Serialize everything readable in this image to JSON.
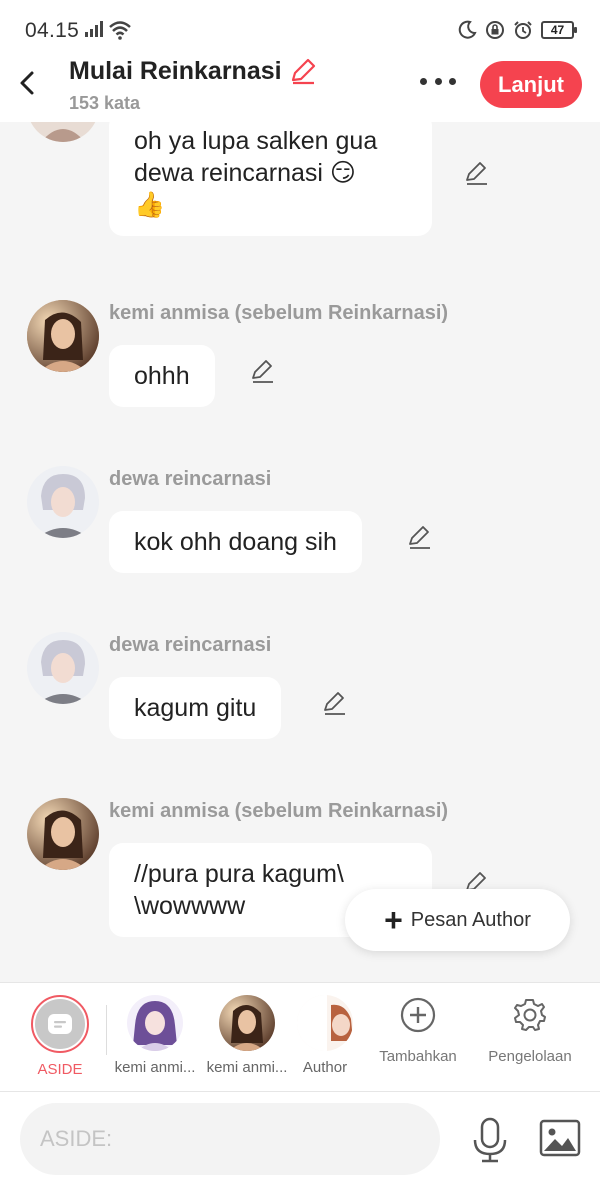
{
  "status": {
    "time": "04.15",
    "battery": "47"
  },
  "header": {
    "title": "Mulai Reinkarnasi",
    "word_count": "153 kata",
    "next_label": "Lanjut"
  },
  "messages": [
    {
      "sender": "",
      "text": "oh ya lupa salken gua dewa reincarnasi 😏 👍",
      "lines": [
        "oh ya lupa salken gua",
        "dewa reincarnasi 😏",
        "👍"
      ]
    },
    {
      "sender": "kemi anmisa (sebelum Reinkarnasi)",
      "text": "ohhh"
    },
    {
      "sender": "dewa reincarnasi",
      "text": "kok ohh doang sih"
    },
    {
      "sender": "dewa reincarnasi",
      "text": "kagum gitu"
    },
    {
      "sender": "kemi anmisa (sebelum Reinkarnasi)",
      "lines": [
        "//pura pura kagum\\",
        "\\wowwww"
      ]
    }
  ],
  "fab": {
    "label": "Pesan Author"
  },
  "characters": [
    {
      "label": "ASIDE"
    },
    {
      "label": "kemi anmi..."
    },
    {
      "label": "kemi anmi..."
    },
    {
      "label": "Author"
    }
  ],
  "tools": {
    "add_label": "Tambahkan",
    "manage_label": "Pengelolaan"
  },
  "input": {
    "placeholder": "ASIDE:"
  },
  "colors": {
    "accent": "#f5434f",
    "background": "#f5f5f5",
    "bubble": "#ffffff"
  }
}
